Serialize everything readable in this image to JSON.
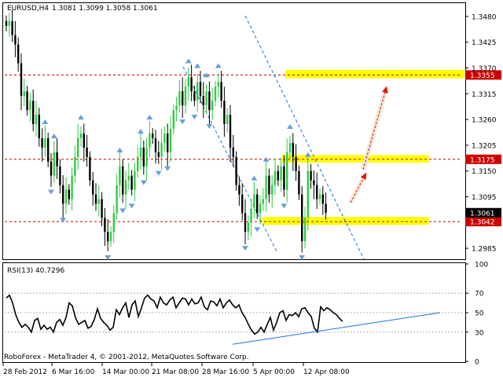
{
  "header": {
    "symbol": "EURUSD,H4",
    "ohlc": "1.3081 1.3099 1.3058 1.3061"
  },
  "footer": {
    "copyright": "RoboForex - MetaTrader 4, © 2001-2012, MetaQuotes Software Corp."
  },
  "colors": {
    "bull": "#2ecc40",
    "bear": "#000000",
    "levels": "#cc0000",
    "zones": "#ffff00",
    "channel": "#1e6fd9",
    "arrows": "#e01010",
    "fractal": "#6b9ed6",
    "rsi_line": "#000000",
    "rsi_trend": "#1e6fd9"
  },
  "chart_data": [
    {
      "type": "candlestick",
      "title": "EURUSD,H4",
      "ylim": [
        1.2965,
        1.3505
      ],
      "y_ticks": [
        "1.3480",
        "1.3425",
        "1.3370",
        "1.3315",
        "1.3260",
        "1.3205",
        "1.3150",
        "1.3095",
        "1.2985"
      ],
      "x_ticks": [
        "28 Feb 2012",
        "6 Mar 16:00",
        "14 Mar 00:00",
        "21 Mar 08:00",
        "28 Mar 16:00",
        "5 Apr 00:00",
        "12 Apr 08:00"
      ],
      "current_price": "1.3061",
      "levels": [
        {
          "value": 1.3355,
          "label": "1.3355"
        },
        {
          "value": 1.3175,
          "label": "1.3175"
        },
        {
          "value": 1.3042,
          "label": "1.3042"
        }
      ],
      "zones": [
        {
          "from": "31 Mar",
          "to": "20 Apr",
          "low": 1.3348,
          "high": 1.3366
        },
        {
          "from": "2 Apr",
          "to": "17 Apr",
          "low": 1.3168,
          "high": 1.3184
        },
        {
          "from": "1 Apr",
          "to": "17 Apr",
          "low": 1.3035,
          "high": 1.3052
        }
      ],
      "closes": [
        1.346,
        1.347,
        1.344,
        1.342,
        1.338,
        1.331,
        1.332,
        1.328,
        1.33,
        1.325,
        1.327,
        1.322,
        1.32,
        1.322,
        1.317,
        1.314,
        1.319,
        1.316,
        1.312,
        1.308,
        1.311,
        1.309,
        1.314,
        1.318,
        1.322,
        1.323,
        1.32,
        1.318,
        1.313,
        1.31,
        1.308,
        1.309,
        1.305,
        1.302,
        1.3,
        1.302,
        1.306,
        1.312,
        1.316,
        1.31,
        1.313,
        1.314,
        1.311,
        1.315,
        1.318,
        1.32,
        1.316,
        1.32,
        1.323,
        1.322,
        1.319,
        1.318,
        1.321,
        1.323,
        1.319,
        1.324,
        1.328,
        1.329,
        1.332,
        1.329,
        1.333,
        1.335,
        1.332,
        1.33,
        1.334,
        1.331,
        1.329,
        1.332,
        1.328,
        1.33,
        1.333,
        1.334,
        1.33,
        1.325,
        1.327,
        1.32,
        1.318,
        1.312,
        1.31,
        1.306,
        1.302,
        1.304,
        1.307,
        1.31,
        1.306,
        1.308,
        1.309,
        1.314,
        1.31,
        1.312,
        1.315,
        1.313,
        1.316,
        1.311,
        1.319,
        1.321,
        1.318,
        1.315,
        1.31,
        1.3,
        1.305,
        1.315,
        1.313,
        1.312,
        1.309,
        1.31,
        1.308,
        1.3061
      ]
    },
    {
      "type": "line",
      "title": "RSI(13) 40.7296",
      "ylim": [
        0,
        100
      ],
      "y_ticks": [
        "100",
        "70",
        "50",
        "30",
        "0"
      ],
      "series": [
        {
          "values": [
            65,
            68,
            60,
            48,
            40,
            35,
            38,
            35,
            30,
            42,
            44,
            33,
            37,
            33,
            35,
            30,
            40,
            43,
            37,
            45,
            60,
            57,
            45,
            38,
            40,
            42,
            34,
            36,
            43,
            54,
            44,
            40,
            37,
            32,
            35,
            53,
            48,
            55,
            60,
            45,
            58,
            62,
            46,
            55,
            65,
            68,
            64,
            62,
            55,
            66,
            60,
            58,
            63,
            66,
            55,
            60,
            65,
            64,
            58,
            64,
            59,
            60,
            66,
            56,
            53,
            62,
            61,
            57,
            64,
            55,
            60,
            63,
            58,
            55,
            58,
            50,
            45,
            38,
            32,
            28,
            30,
            35,
            30,
            38,
            45,
            32,
            40,
            50,
            52,
            42,
            48,
            47,
            50,
            46,
            54,
            55,
            50,
            46,
            34,
            30,
            56,
            52,
            55,
            53,
            50,
            48,
            44,
            41
          ]
        }
      ],
      "trendline": {
        "from": [
          79,
          20
        ],
        "to": [
          146,
          50
        ]
      }
    }
  ]
}
